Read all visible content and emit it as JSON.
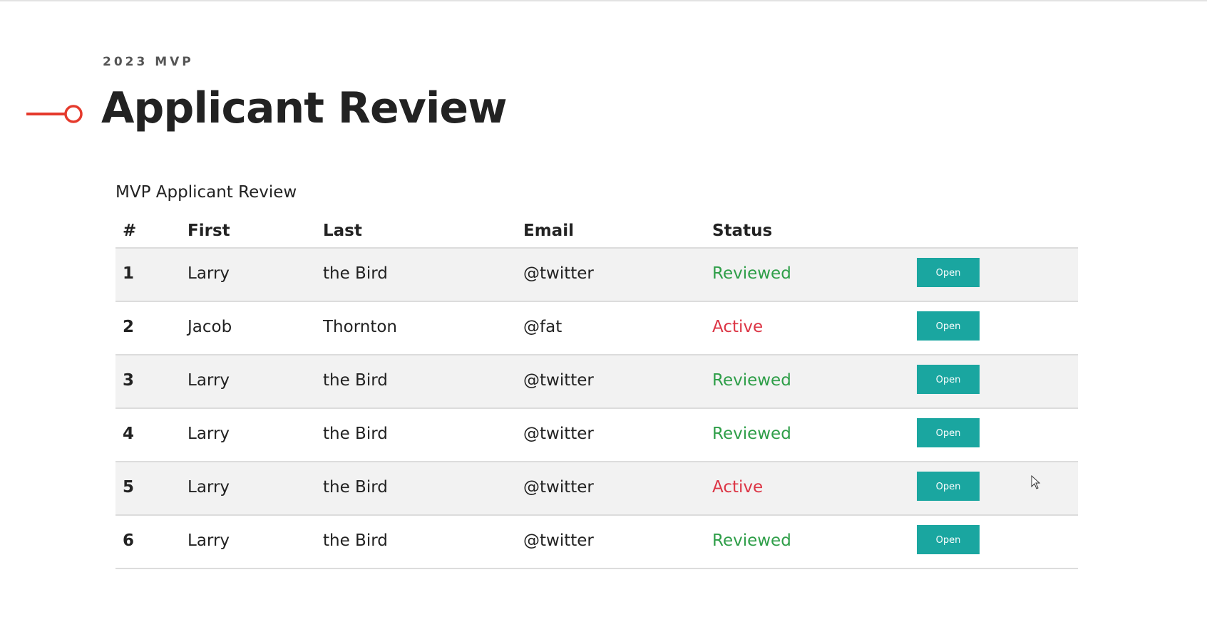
{
  "header": {
    "eyebrow": "2023 MVP",
    "title": "Applicant Review",
    "accent": "#e53a2c"
  },
  "table": {
    "caption": "MVP Applicant Review",
    "columns": [
      "#",
      "First",
      "Last",
      "Email",
      "Status",
      ""
    ],
    "rows": [
      {
        "num": "1",
        "first": "Larry",
        "last": "the Bird",
        "email": "@twitter",
        "status": "Reviewed",
        "action": "Open"
      },
      {
        "num": "2",
        "first": "Jacob",
        "last": "Thornton",
        "email": "@fat",
        "status": "Active",
        "action": "Open"
      },
      {
        "num": "3",
        "first": "Larry",
        "last": "the Bird",
        "email": "@twitter",
        "status": "Reviewed",
        "action": "Open"
      },
      {
        "num": "4",
        "first": "Larry",
        "last": "the Bird",
        "email": "@twitter",
        "status": "Reviewed",
        "action": "Open"
      },
      {
        "num": "5",
        "first": "Larry",
        "last": "the Bird",
        "email": "@twitter",
        "status": "Active",
        "action": "Open"
      },
      {
        "num": "6",
        "first": "Larry",
        "last": "the Bird",
        "email": "@twitter",
        "status": "Reviewed",
        "action": "Open"
      }
    ]
  },
  "colors": {
    "reviewed": "#2e9e48",
    "active": "#dc3545",
    "button": "#1aa6a0"
  }
}
